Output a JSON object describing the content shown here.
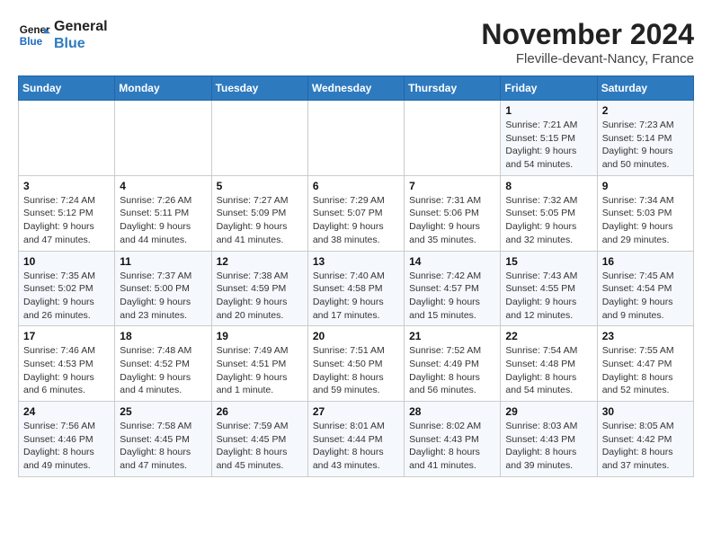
{
  "logo": {
    "line1": "General",
    "line2": "Blue"
  },
  "title": "November 2024",
  "location": "Fleville-devant-Nancy, France",
  "weekdays": [
    "Sunday",
    "Monday",
    "Tuesday",
    "Wednesday",
    "Thursday",
    "Friday",
    "Saturday"
  ],
  "weeks": [
    [
      {
        "day": "",
        "info": ""
      },
      {
        "day": "",
        "info": ""
      },
      {
        "day": "",
        "info": ""
      },
      {
        "day": "",
        "info": ""
      },
      {
        "day": "",
        "info": ""
      },
      {
        "day": "1",
        "info": "Sunrise: 7:21 AM\nSunset: 5:15 PM\nDaylight: 9 hours and 54 minutes."
      },
      {
        "day": "2",
        "info": "Sunrise: 7:23 AM\nSunset: 5:14 PM\nDaylight: 9 hours and 50 minutes."
      }
    ],
    [
      {
        "day": "3",
        "info": "Sunrise: 7:24 AM\nSunset: 5:12 PM\nDaylight: 9 hours and 47 minutes."
      },
      {
        "day": "4",
        "info": "Sunrise: 7:26 AM\nSunset: 5:11 PM\nDaylight: 9 hours and 44 minutes."
      },
      {
        "day": "5",
        "info": "Sunrise: 7:27 AM\nSunset: 5:09 PM\nDaylight: 9 hours and 41 minutes."
      },
      {
        "day": "6",
        "info": "Sunrise: 7:29 AM\nSunset: 5:07 PM\nDaylight: 9 hours and 38 minutes."
      },
      {
        "day": "7",
        "info": "Sunrise: 7:31 AM\nSunset: 5:06 PM\nDaylight: 9 hours and 35 minutes."
      },
      {
        "day": "8",
        "info": "Sunrise: 7:32 AM\nSunset: 5:05 PM\nDaylight: 9 hours and 32 minutes."
      },
      {
        "day": "9",
        "info": "Sunrise: 7:34 AM\nSunset: 5:03 PM\nDaylight: 9 hours and 29 minutes."
      }
    ],
    [
      {
        "day": "10",
        "info": "Sunrise: 7:35 AM\nSunset: 5:02 PM\nDaylight: 9 hours and 26 minutes."
      },
      {
        "day": "11",
        "info": "Sunrise: 7:37 AM\nSunset: 5:00 PM\nDaylight: 9 hours and 23 minutes."
      },
      {
        "day": "12",
        "info": "Sunrise: 7:38 AM\nSunset: 4:59 PM\nDaylight: 9 hours and 20 minutes."
      },
      {
        "day": "13",
        "info": "Sunrise: 7:40 AM\nSunset: 4:58 PM\nDaylight: 9 hours and 17 minutes."
      },
      {
        "day": "14",
        "info": "Sunrise: 7:42 AM\nSunset: 4:57 PM\nDaylight: 9 hours and 15 minutes."
      },
      {
        "day": "15",
        "info": "Sunrise: 7:43 AM\nSunset: 4:55 PM\nDaylight: 9 hours and 12 minutes."
      },
      {
        "day": "16",
        "info": "Sunrise: 7:45 AM\nSunset: 4:54 PM\nDaylight: 9 hours and 9 minutes."
      }
    ],
    [
      {
        "day": "17",
        "info": "Sunrise: 7:46 AM\nSunset: 4:53 PM\nDaylight: 9 hours and 6 minutes."
      },
      {
        "day": "18",
        "info": "Sunrise: 7:48 AM\nSunset: 4:52 PM\nDaylight: 9 hours and 4 minutes."
      },
      {
        "day": "19",
        "info": "Sunrise: 7:49 AM\nSunset: 4:51 PM\nDaylight: 9 hours and 1 minute."
      },
      {
        "day": "20",
        "info": "Sunrise: 7:51 AM\nSunset: 4:50 PM\nDaylight: 8 hours and 59 minutes."
      },
      {
        "day": "21",
        "info": "Sunrise: 7:52 AM\nSunset: 4:49 PM\nDaylight: 8 hours and 56 minutes."
      },
      {
        "day": "22",
        "info": "Sunrise: 7:54 AM\nSunset: 4:48 PM\nDaylight: 8 hours and 54 minutes."
      },
      {
        "day": "23",
        "info": "Sunrise: 7:55 AM\nSunset: 4:47 PM\nDaylight: 8 hours and 52 minutes."
      }
    ],
    [
      {
        "day": "24",
        "info": "Sunrise: 7:56 AM\nSunset: 4:46 PM\nDaylight: 8 hours and 49 minutes."
      },
      {
        "day": "25",
        "info": "Sunrise: 7:58 AM\nSunset: 4:45 PM\nDaylight: 8 hours and 47 minutes."
      },
      {
        "day": "26",
        "info": "Sunrise: 7:59 AM\nSunset: 4:45 PM\nDaylight: 8 hours and 45 minutes."
      },
      {
        "day": "27",
        "info": "Sunrise: 8:01 AM\nSunset: 4:44 PM\nDaylight: 8 hours and 43 minutes."
      },
      {
        "day": "28",
        "info": "Sunrise: 8:02 AM\nSunset: 4:43 PM\nDaylight: 8 hours and 41 minutes."
      },
      {
        "day": "29",
        "info": "Sunrise: 8:03 AM\nSunset: 4:43 PM\nDaylight: 8 hours and 39 minutes."
      },
      {
        "day": "30",
        "info": "Sunrise: 8:05 AM\nSunset: 4:42 PM\nDaylight: 8 hours and 37 minutes."
      }
    ]
  ]
}
